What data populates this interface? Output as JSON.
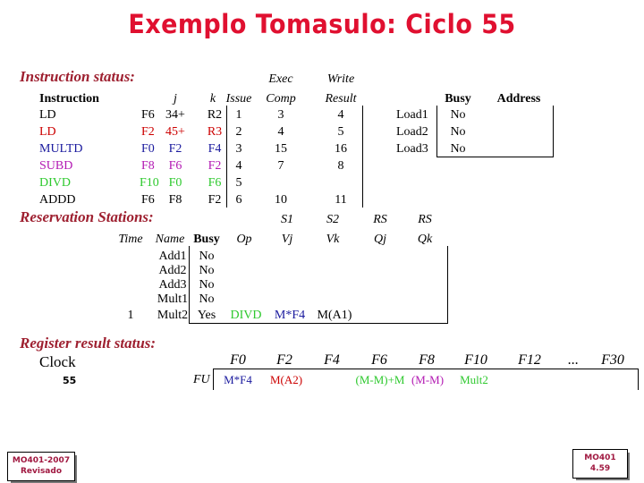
{
  "slide": {
    "title": "Exemplo Tomasulo: Ciclo 55",
    "title_color": "#e01030"
  },
  "instruction_status": {
    "heading": "Instruction status:",
    "headers_top": [
      "Exec",
      "Write"
    ],
    "headers": [
      "Instruction",
      "j",
      "k",
      "Issue",
      "Comp",
      "Result"
    ],
    "rows": [
      {
        "op": "LD",
        "dest": "F6",
        "j": "34+",
        "k": "R2",
        "issue": "1",
        "exec_comp": "3",
        "write_result": "4",
        "color": "#000000"
      },
      {
        "op": "LD",
        "dest": "F2",
        "j": "45+",
        "k": "R3",
        "issue": "2",
        "exec_comp": "4",
        "write_result": "5",
        "color": "#cc0000"
      },
      {
        "op": "MULTD",
        "dest": "F0",
        "j": "F2",
        "k": "F4",
        "issue": "3",
        "exec_comp": "15",
        "write_result": "16",
        "color": "#1a1a9e"
      },
      {
        "op": "SUBD",
        "dest": "F8",
        "j": "F6",
        "k": "F2",
        "issue": "4",
        "exec_comp": "7",
        "write_result": "8",
        "color": "#b31ab3"
      },
      {
        "op": "DIVD",
        "dest": "F10",
        "j": "F0",
        "k": "F6",
        "issue": "5",
        "exec_comp": "",
        "write_result": "",
        "color": "#2ec92e"
      },
      {
        "op": "ADDD",
        "dest": "F6",
        "j": "F8",
        "k": "F2",
        "issue": "6",
        "exec_comp": "10",
        "write_result": "11",
        "color": "#000000"
      }
    ]
  },
  "load_buffers": {
    "headers": [
      "Busy",
      "Address"
    ],
    "rows": [
      {
        "name": "Load1",
        "busy": "No",
        "address": ""
      },
      {
        "name": "Load2",
        "busy": "No",
        "address": ""
      },
      {
        "name": "Load3",
        "busy": "No",
        "address": ""
      }
    ]
  },
  "reservation_stations": {
    "heading": "Reservation Stations:",
    "headers_top": [
      "S1",
      "S2",
      "RS",
      "RS"
    ],
    "headers": [
      "Time",
      "Name",
      "Busy",
      "Op",
      "Vj",
      "Vk",
      "Qj",
      "Qk"
    ],
    "rows": [
      {
        "time": "",
        "name": "Add1",
        "busy": "No",
        "op": "",
        "vj": "",
        "vk": "",
        "qj": "",
        "qk": "",
        "op_color": "#000000",
        "vj_color": "#000000",
        "vk_color": "#000000"
      },
      {
        "time": "",
        "name": "Add2",
        "busy": "No",
        "op": "",
        "vj": "",
        "vk": "",
        "qj": "",
        "qk": "",
        "op_color": "#000000",
        "vj_color": "#000000",
        "vk_color": "#000000"
      },
      {
        "time": "",
        "name": "Add3",
        "busy": "No",
        "op": "",
        "vj": "",
        "vk": "",
        "qj": "",
        "qk": "",
        "op_color": "#000000",
        "vj_color": "#000000",
        "vk_color": "#000000"
      },
      {
        "time": "",
        "name": "Mult1",
        "busy": "No",
        "op": "",
        "vj": "",
        "vk": "",
        "qj": "",
        "qk": "",
        "op_color": "#000000",
        "vj_color": "#000000",
        "vk_color": "#000000"
      },
      {
        "time": "1",
        "name": "Mult2",
        "busy": "Yes",
        "op": "DIVD",
        "vj": "M*F4",
        "vk": "M(A1)",
        "qj": "",
        "qk": "",
        "op_color": "#2ec92e",
        "vj_color": "#1a1a9e",
        "vk_color": "#000000"
      }
    ]
  },
  "register_result_status": {
    "heading": "Register result status:",
    "clock_label": "Clock",
    "clock_value": "55",
    "fu_label": "FU",
    "registers": [
      "F0",
      "F2",
      "F4",
      "F6",
      "F8",
      "F10",
      "F12",
      "...",
      "F30"
    ],
    "values": [
      {
        "reg": "F0",
        "value": "M*F4",
        "color": "#1a1a9e"
      },
      {
        "reg": "F2",
        "value": "M(A2)",
        "color": "#cc0000"
      },
      {
        "reg": "F4",
        "value": "",
        "color": "#000000"
      },
      {
        "reg": "F6",
        "value": "(M-M)+M",
        "color": "#2ec92e"
      },
      {
        "reg": "F8",
        "value": "(M-M)",
        "color": "#b31ab3"
      },
      {
        "reg": "F10",
        "value": "Mult2",
        "color": "#2ec92e"
      },
      {
        "reg": "F12",
        "value": "",
        "color": "#000000"
      },
      {
        "reg": "F30",
        "value": "",
        "color": "#000000"
      }
    ]
  },
  "footer": {
    "left_line1": "MO401-2007",
    "left_line2": "Revisado",
    "right_line1": "MO401",
    "right_line2": "4.59"
  }
}
